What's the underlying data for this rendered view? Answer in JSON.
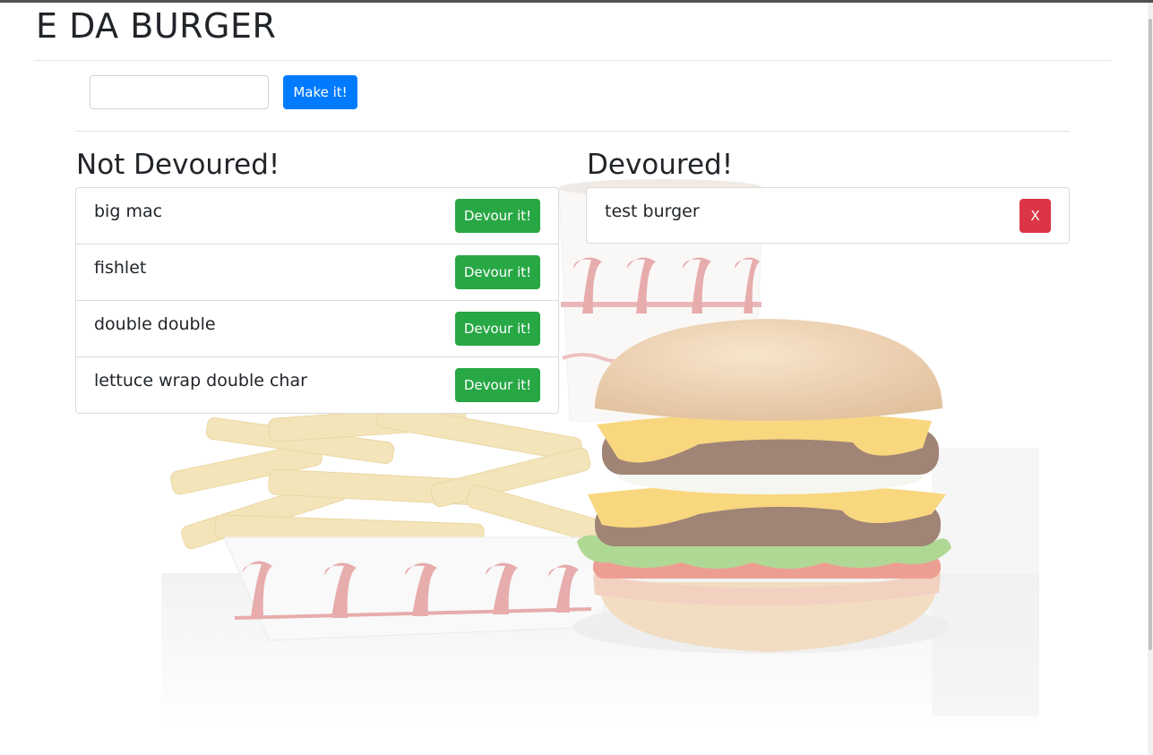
{
  "header": {
    "title": "E DA BURGER"
  },
  "form": {
    "input_value": "",
    "input_placeholder": "",
    "submit_label": "Make it!"
  },
  "not_devoured": {
    "heading": "Not Devoured!",
    "button_label": "Devour it!",
    "items": [
      {
        "name": "big mac"
      },
      {
        "name": "fishlet"
      },
      {
        "name": "double double"
      },
      {
        "name": "lettuce wrap double char"
      }
    ]
  },
  "devoured": {
    "heading": "Devoured!",
    "button_label": "X",
    "items": [
      {
        "name": "test burger"
      }
    ]
  },
  "background": {
    "image": "faded burger-fries-drink-photo",
    "icons": [
      "burger-icon",
      "fries-icon",
      "drink-cup-icon"
    ]
  },
  "colors": {
    "primary": "#007bff",
    "success": "#28a745",
    "danger": "#dc3545",
    "text": "#212529"
  }
}
